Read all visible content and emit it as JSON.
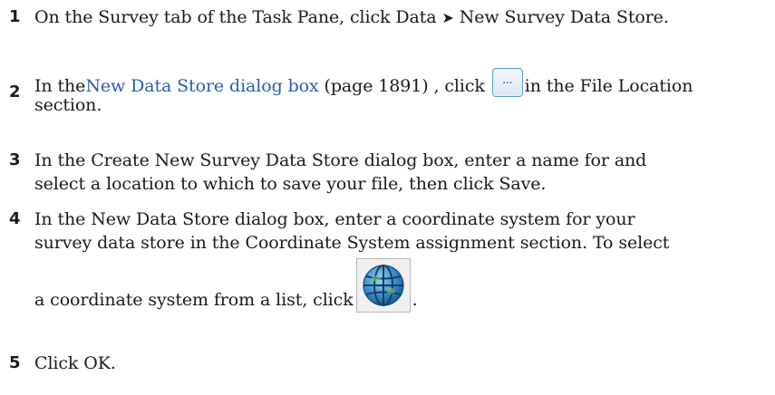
{
  "steps": [
    {
      "number": "1",
      "text_before": "On the Survey tab of the Task Pane, click Data ",
      "arrow": "➤",
      "text_after": " New Survey Data Store."
    },
    {
      "number": "2",
      "prefix": "In the",
      "link_text": "New Data Store dialog box",
      "page_ref": " (page 1891) , click",
      "button_label": "...",
      "suffix_line1": "in the File Location",
      "suffix_line2": "section."
    },
    {
      "number": "3",
      "line1": "In the Create New Survey Data Store dialog box, enter a name for and",
      "line2": "select a location to which to save your file, then click Save."
    },
    {
      "number": "4",
      "line1": "In the New Data Store dialog box, enter a coordinate system for your",
      "line2": "survey data store in the Coordinate System assignment section. To select",
      "line3": "a coordinate system from a list, click",
      "line3_end": "."
    },
    {
      "number": "5",
      "text": "Click OK."
    }
  ],
  "icons": {
    "browse": "ellipsis-button-icon",
    "globe": "globe-icon"
  }
}
